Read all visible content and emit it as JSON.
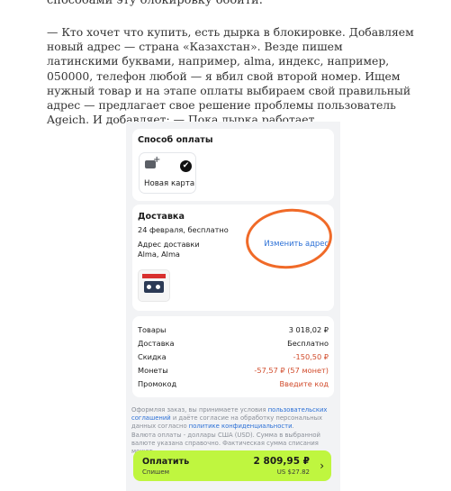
{
  "article": {
    "top_line": "способами эту блокировку обойти.",
    "paragraph": "— Кто хочет что купить, есть дырка в блокировке. Добавляем новый адрес — страна «Казахстан». Везде пишем латинскими буквами, например, alma, индекс, например, 050000, телефон любой — я вбил свой второй номер. Ищем нужный товар и на этапе оплаты выбираем свой правильный адрес — предлагает свое решение проблемы пользователь Ageich. И добавляет: — Пока дырка работает."
  },
  "checkout": {
    "payment": {
      "title": "Способ оплаты",
      "new_card_label": "Новая карта",
      "check": "✔"
    },
    "delivery": {
      "title": "Доставка",
      "date": "24 февраля, бесплатно",
      "address_label": "Адрес доставки",
      "address_value": "Alma, Alma",
      "change_link": "Изменить адрес"
    },
    "summary": {
      "rows": [
        {
          "label": "Товары",
          "value": "3 018,02 ₽"
        },
        {
          "label": "Доставка",
          "value": "Бесплатно"
        },
        {
          "label": "Скидка",
          "value": "-150,50 ₽"
        },
        {
          "label": "Монеты",
          "value": "-57,57 ₽ (57 монет)"
        },
        {
          "label": "Промокод",
          "value": "Введите код"
        }
      ]
    },
    "legal": {
      "part1": "Оформляя заказ, вы принимаете условия ",
      "link1": "пользовательских соглашений",
      "part2": " и даёте согласие на обработку персональных данных согласно ",
      "link2": "политике конфиденциальности",
      "part3": ".",
      "currency_note": "Валюта оплаты - доллары США (USD). Сумма в выбранной валюте указана справочно. Фактическая сумма списания может"
    },
    "pay_button": {
      "label": "Оплатить",
      "sublabel": "Спишем",
      "amount": "2 809,95 ₽",
      "amount_usd": "US $27.82",
      "arrow": "›"
    },
    "colors": {
      "accent_green": "#bff63f",
      "link_blue": "#2a6fd6",
      "annotation_orange": "#f06a28",
      "discount_red": "#d14b2b"
    }
  }
}
